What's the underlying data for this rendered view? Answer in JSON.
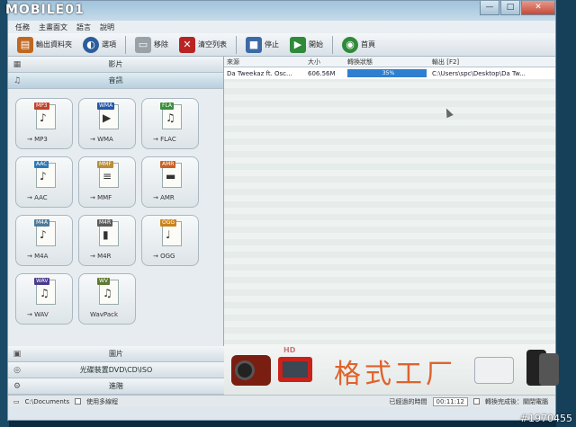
{
  "brand": "MOBILE01",
  "watermark": "#1970455",
  "window": {
    "controls": [
      "—",
      "□",
      "✕"
    ],
    "menu": [
      "任務",
      "主畫面文",
      "語言",
      "說明"
    ]
  },
  "toolbar": [
    {
      "label": "輸出資料夾",
      "icon": "folder-output-icon",
      "color": "#c0681f"
    },
    {
      "label": "選項",
      "icon": "options-icon",
      "color": "#2c5d9c"
    },
    {
      "label": "移除",
      "icon": "remove-icon",
      "color": "#9aa2a8"
    },
    {
      "label": "清空列表",
      "icon": "clear-list-icon",
      "color": "#b82424"
    },
    {
      "label": "停止",
      "icon": "stop-icon",
      "color": "#3c6aa6"
    },
    {
      "label": "開始",
      "icon": "start-icon",
      "color": "#2f8a3a"
    },
    {
      "label": "首頁",
      "icon": "home-icon",
      "color": "#2f8a3a"
    }
  ],
  "categories_top": [
    {
      "label": "影片",
      "icon": "video-icon"
    },
    {
      "label": "音訊",
      "icon": "audio-icon"
    }
  ],
  "formats": [
    {
      "tag": "MP3",
      "label": "→ MP3",
      "glyph": "♪",
      "color": "#c0432a"
    },
    {
      "tag": "WMA",
      "label": "→ WMA",
      "glyph": "▶",
      "color": "#2457a8"
    },
    {
      "tag": "FLA",
      "label": "→ FLAC",
      "glyph": "♫",
      "color": "#3b8e3b"
    },
    {
      "tag": "AAC",
      "label": "→ AAC",
      "glyph": "♪",
      "color": "#2a79b8"
    },
    {
      "tag": "MMF",
      "label": "→ MMF",
      "glyph": "≡",
      "color": "#b88d3c"
    },
    {
      "tag": "AMR",
      "label": "→ AMR",
      "glyph": "▬",
      "color": "#c66225"
    },
    {
      "tag": "M4A",
      "label": "→ M4A",
      "glyph": "♪",
      "color": "#4d7a9c"
    },
    {
      "tag": "M4R",
      "label": "→ M4R",
      "glyph": "▮",
      "color": "#5b5b5b"
    },
    {
      "tag": "OGG",
      "label": "→ OGG",
      "glyph": "♩",
      "color": "#c9831c"
    },
    {
      "tag": "WAV",
      "label": "→ WAV",
      "glyph": "♫",
      "color": "#4a3b8e"
    },
    {
      "tag": "WV",
      "label": "WavPack",
      "glyph": "♫",
      "color": "#5e7a32"
    }
  ],
  "categories_bottom": [
    {
      "label": "圖片",
      "icon": "picture-icon"
    },
    {
      "label": "光碟裝置DVD\\CD\\ISO",
      "icon": "disc-icon"
    },
    {
      "label": "進階",
      "icon": "advanced-icon"
    }
  ],
  "status_left": {
    "path": "C:\\Documents",
    "checkbox_label": "使用多線程"
  },
  "table": {
    "headers": [
      "來源",
      "大小",
      "轉換狀態",
      "輸出 [F2]"
    ],
    "rows": [
      {
        "source": "Da Tweekaz ft. Osc...",
        "size": "606.56M",
        "status": "35%",
        "progress": 0.35,
        "output": "C:\\Users\\spc\\Desktop\\Da Tw..."
      }
    ]
  },
  "banner": {
    "title": "格式工厂",
    "hd_tag": "HD"
  },
  "status_right": {
    "elapsed_label": "已經過的時間",
    "elapsed": "00:11:12",
    "shutdown_label": "轉換完成後：關閉電腦"
  }
}
